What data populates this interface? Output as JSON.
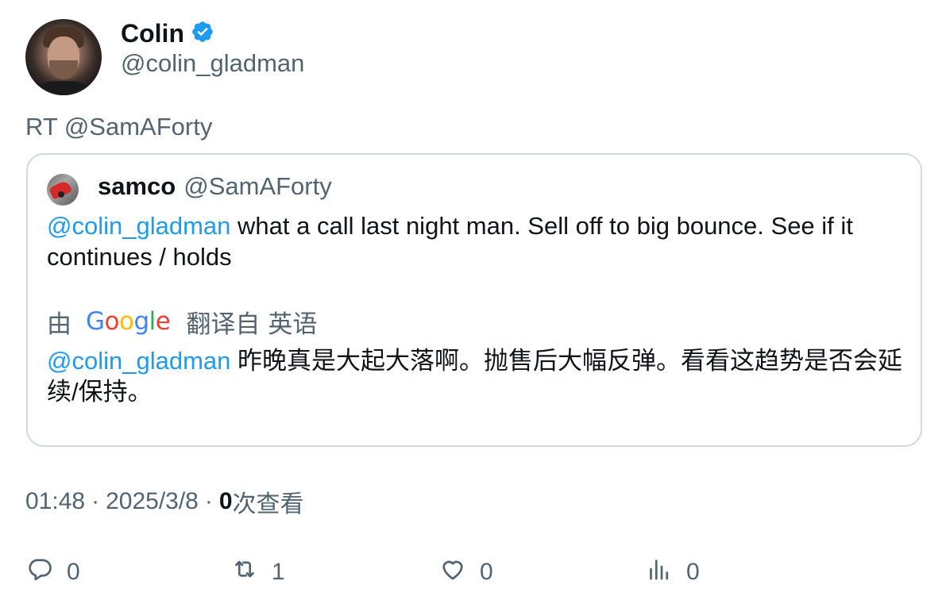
{
  "author": {
    "name": "Colin",
    "handle": "@colin_gladman",
    "verified": true
  },
  "retweet_label": "RT @SamAForty",
  "quote": {
    "name": "samco",
    "handle": "@SamAForty",
    "mention": "@colin_gladman",
    "text_line": "what a call last night man. Sell off to big bounce. See if it continues / holds",
    "translation": {
      "by": "由",
      "provider": "Google",
      "from": "翻译自",
      "language": "英语",
      "mention": "@colin_gladman",
      "text": "昨晚真是大起大落啊。抛售后大幅反弹。看看这趋势是否会延续/保持。"
    }
  },
  "meta": {
    "time": "01:48",
    "date": "2025/3/8",
    "views_count": "0",
    "views_label": "次查看"
  },
  "actions": {
    "reply_count": "0",
    "retweet_count": "1",
    "like_count": "0",
    "views_count": "0"
  },
  "colors": {
    "link": "#1d9bf0",
    "muted": "#536471",
    "border": "#cfd9de",
    "verified": "#1d9bf0"
  }
}
